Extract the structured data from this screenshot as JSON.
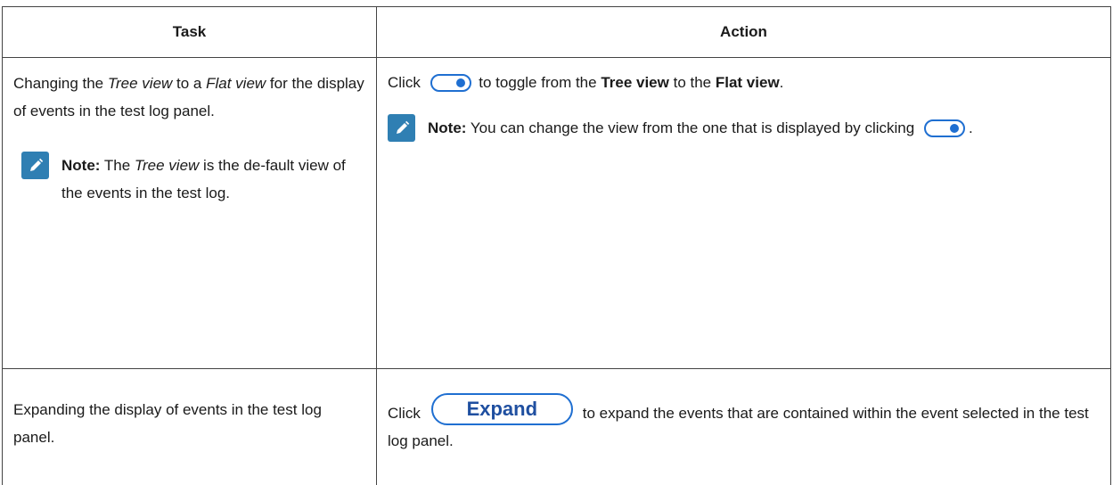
{
  "table": {
    "header": {
      "task": "Task",
      "action": "Action"
    },
    "row1": {
      "task": {
        "p1": "Changing the ",
        "p2": "Tree view",
        "p3": " to a ",
        "p4": "Flat view",
        "p5": " for the display of events in the test log panel.",
        "note_label": "Note:",
        "note_p1": " The ",
        "note_p2": "Tree view",
        "note_p3": " is the de-fault view of the events in the test log."
      },
      "action": {
        "p1": "Click ",
        "p2": " to toggle from the ",
        "p3": "Tree view",
        "p4": " to the ",
        "p5": "Flat view",
        "p6": ".",
        "note_label": "Note:",
        "note_p1": " You can change the view from the one that is displayed by clicking ",
        "note_p2": "."
      }
    },
    "row2": {
      "task": {
        "p1": "Expanding the display of events in the test log panel."
      },
      "action": {
        "p1": "Click ",
        "button_label": "Expand",
        "p2": " to expand the events that are contained within the event selected in the test log panel."
      }
    }
  },
  "icons": {
    "note": "pencil-icon",
    "toggle": "toggle-switch-icon"
  },
  "colors": {
    "note_icon_bg": "#2f7fb3",
    "toggle_accent": "#1f6fd1",
    "expand_text": "#1f4fa0",
    "border": "#444444"
  }
}
